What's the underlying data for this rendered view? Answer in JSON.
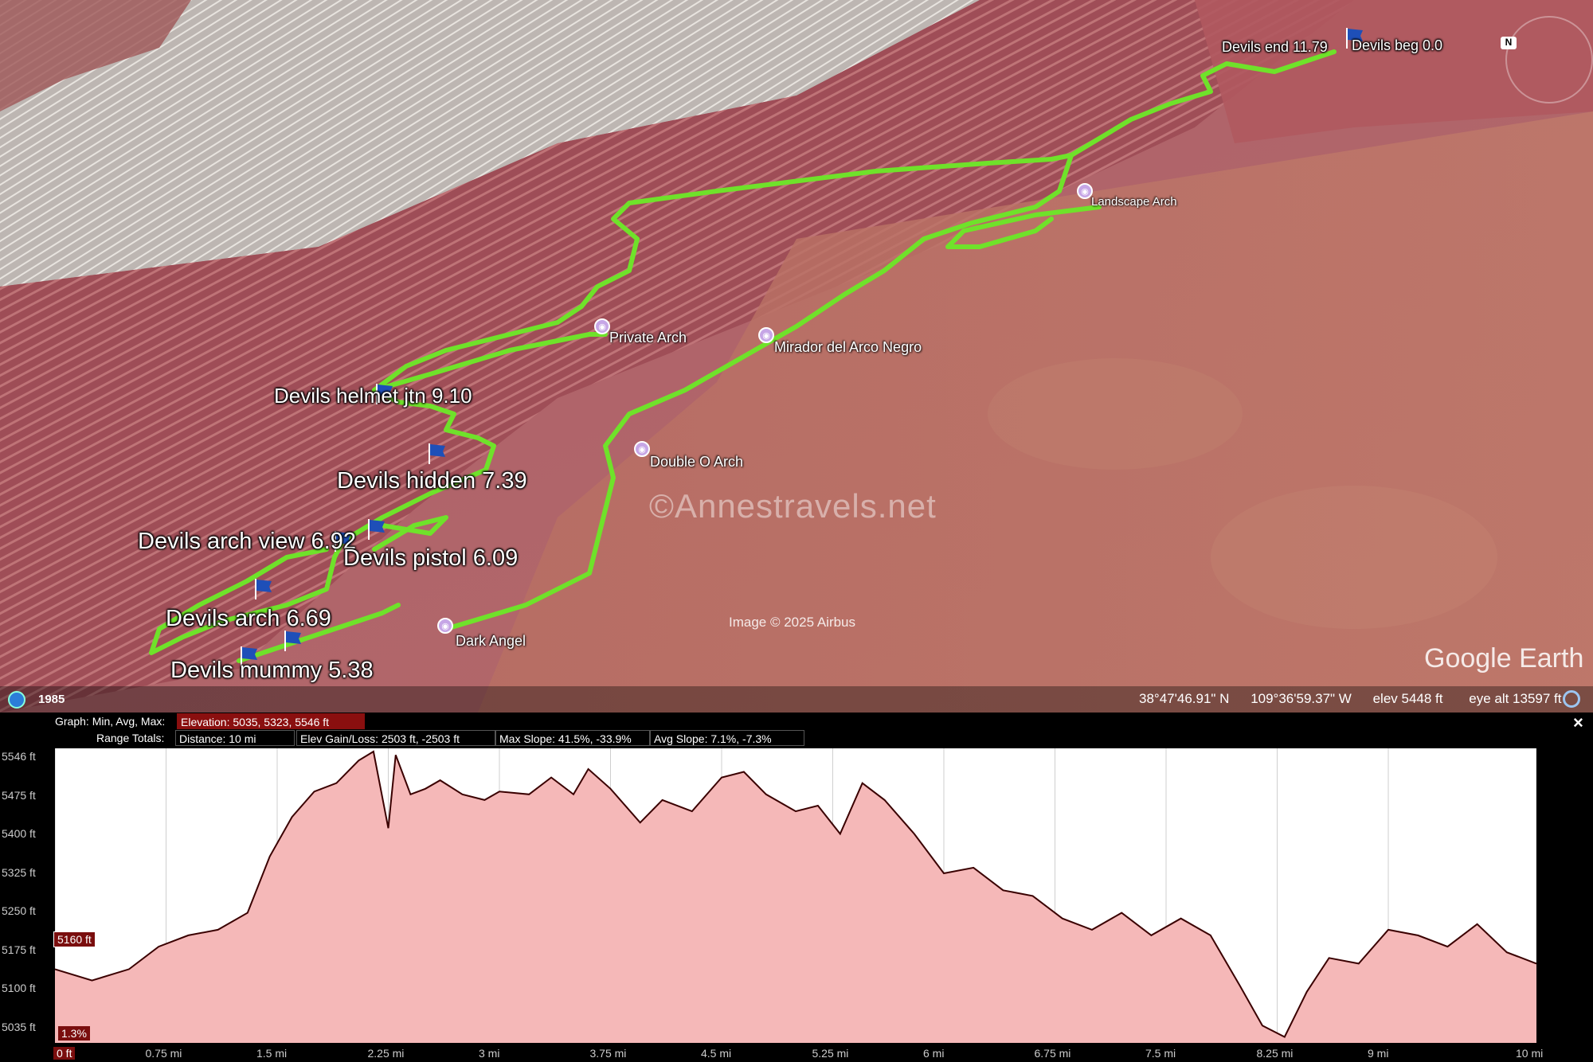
{
  "map": {
    "waypoints": [
      {
        "id": "devils-end",
        "label": "Devils end 11.79"
      },
      {
        "id": "devils-beg",
        "label": "Devils beg 0.0"
      },
      {
        "id": "devils-helmet",
        "label": "Devils helmet jtn 9.10"
      },
      {
        "id": "devils-hidden",
        "label": "Devils hidden 7.39"
      },
      {
        "id": "devils-arch-view",
        "label": "Devils arch view 6.92"
      },
      {
        "id": "devils-pistol",
        "label": "Devils pistol 6.09"
      },
      {
        "id": "devils-arch",
        "label": "Devils arch 6.69"
      },
      {
        "id": "devils-mummy",
        "label": "Devils mummy 5.38"
      }
    ],
    "pois": [
      {
        "id": "landscape-arch",
        "label": "Landscape Arch"
      },
      {
        "id": "private-arch",
        "label": "Private Arch"
      },
      {
        "id": "mirador",
        "label": "Mirador del Arco Negro"
      },
      {
        "id": "double-o-arch",
        "label": "Double O Arch"
      },
      {
        "id": "dark-angel",
        "label": "Dark Angel"
      }
    ],
    "watermark": "©Annestravels.net",
    "imagery_credit": "Image © 2025 Airbus",
    "logo": "Google Earth",
    "year": "1985",
    "latitude": "38°47'46.91\" N",
    "longitude": "109°36'59.37\" W",
    "elev": "elev  5448 ft",
    "eye_alt": "eye alt  13597 ft",
    "compass_label": "N",
    "track_color": "#6fe22a"
  },
  "profile": {
    "graph_label": "Graph: Min, Avg, Max:",
    "elevation_stat": "Elevation: 5035, 5323, 5546 ft",
    "range_label": "Range Totals:",
    "distance": "Distance: 10 mi",
    "elev_gain_loss": "Elev Gain/Loss: 2503 ft, -2503 ft",
    "max_slope": "Max Slope: 41.5%, -33.9%",
    "avg_slope": "Avg Slope: 7.1%, -7.3%",
    "close": "×",
    "y_ticks": [
      "5546 ft",
      "5475 ft",
      "5400 ft",
      "5325 ft",
      "5250 ft",
      "5175 ft",
      "5100 ft",
      "5035 ft"
    ],
    "x_ticks": [
      "0 ft",
      "0.75 mi",
      "1.5 mi",
      "2.25 mi",
      "3 mi",
      "3.75 mi",
      "4.5 mi",
      "5.25 mi",
      "6 mi",
      "6.75 mi",
      "7.5 mi",
      "8.25 mi",
      "9 mi",
      "10 mi"
    ],
    "cursor_elev": "5160 ft",
    "cursor_slope": "1.3%",
    "fill_color": "#f5b8b8",
    "line_color": "#3a0000"
  },
  "chart_data": {
    "type": "area",
    "title": "",
    "xlabel": "",
    "ylabel": "",
    "xlim": [
      0,
      10
    ],
    "ylim": [
      5035,
      5546
    ],
    "x": [
      0,
      0.25,
      0.5,
      0.7,
      0.9,
      1.1,
      1.3,
      1.45,
      1.6,
      1.75,
      1.9,
      2.05,
      2.15,
      2.25,
      2.3,
      2.4,
      2.5,
      2.6,
      2.75,
      2.9,
      3.0,
      3.2,
      3.35,
      3.5,
      3.6,
      3.75,
      3.95,
      4.1,
      4.3,
      4.5,
      4.65,
      4.8,
      5.0,
      5.15,
      5.3,
      5.45,
      5.6,
      5.8,
      6.0,
      6.2,
      6.4,
      6.6,
      6.8,
      7.0,
      7.2,
      7.4,
      7.6,
      7.8,
      8.0,
      8.15,
      8.3,
      8.45,
      8.6,
      8.8,
      9.0,
      9.2,
      9.4,
      9.6,
      9.8,
      10.0
    ],
    "y": [
      5160,
      5140,
      5160,
      5200,
      5220,
      5230,
      5260,
      5360,
      5430,
      5475,
      5490,
      5530,
      5546,
      5410,
      5540,
      5470,
      5480,
      5495,
      5470,
      5460,
      5475,
      5470,
      5500,
      5470,
      5515,
      5480,
      5420,
      5460,
      5440,
      5500,
      5510,
      5470,
      5440,
      5450,
      5400,
      5490,
      5460,
      5400,
      5330,
      5340,
      5300,
      5290,
      5250,
      5230,
      5260,
      5220,
      5250,
      5220,
      5130,
      5060,
      5040,
      5120,
      5180,
      5170,
      5230,
      5220,
      5200,
      5240,
      5190,
      5170
    ]
  }
}
